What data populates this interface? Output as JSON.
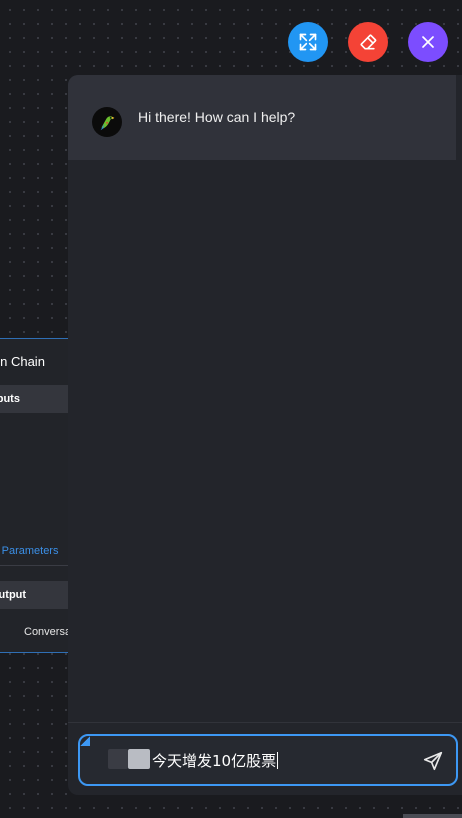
{
  "toolbar": {
    "expand_icon": "expand-icon",
    "clear_icon": "eraser-icon",
    "close_icon": "close-icon",
    "colors": {
      "expand": "#2196f3",
      "clear": "#f44336",
      "close": "#7c4dff"
    }
  },
  "node": {
    "title": "ion Chain",
    "inputs_label": "nputs",
    "params_link": "al Parameters",
    "output_label": "Output",
    "output_item": "Conversa"
  },
  "chat": {
    "bot_avatar": "parrot-avatar",
    "bot_message": "Hi there! How can I help?",
    "input_value": "今天增发10亿股票",
    "send_icon": "send-icon",
    "accent": "#3d98f4"
  }
}
